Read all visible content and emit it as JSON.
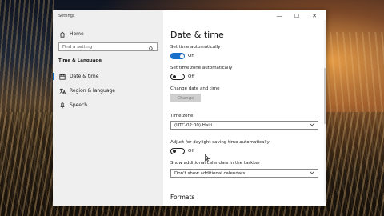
{
  "window": {
    "title": "Settings",
    "controls": {
      "minimize": "—",
      "maximize": "☐",
      "close": "✕"
    }
  },
  "sidebar": {
    "home_label": "Home",
    "search_placeholder": "Find a setting",
    "section_label": "Time & Language",
    "items": [
      {
        "label": "Date & time",
        "icon": "calendar-icon",
        "selected": true
      },
      {
        "label": "Region & language",
        "icon": "language-icon",
        "selected": false
      },
      {
        "label": "Speech",
        "icon": "microphone-icon",
        "selected": false
      }
    ]
  },
  "main": {
    "title": "Date & time",
    "set_time_auto": {
      "label": "Set time automatically",
      "state": "On"
    },
    "set_tz_auto": {
      "label": "Set time zone automatically",
      "state": "Off"
    },
    "change_date": {
      "label": "Change date and time",
      "button": "Change"
    },
    "time_zone": {
      "label": "Time zone",
      "value": "(UTC-02:00) Haiti"
    },
    "dst": {
      "label": "Adjust for daylight saving time automatically",
      "state": "Off"
    },
    "calendars": {
      "label": "Show additional calendars in the taskbar",
      "value": "Don't show additional calendars"
    },
    "formats_heading": "Formats"
  },
  "colors": {
    "accent": "#1a6fc9"
  }
}
